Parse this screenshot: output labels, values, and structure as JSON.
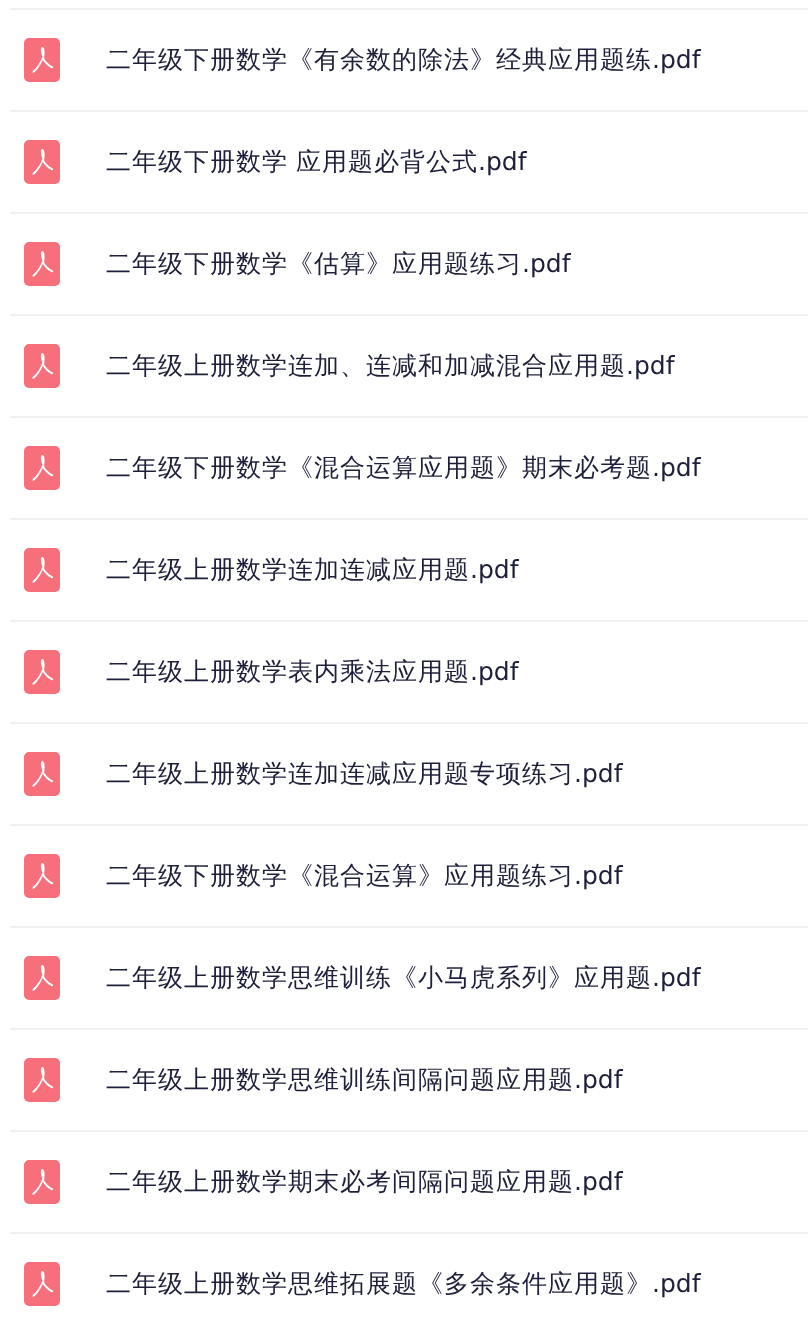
{
  "files": [
    {
      "name": "二年级下册数学《有余数的除法》经典应用题练.pdf"
    },
    {
      "name": "二年级下册数学 应用题必背公式.pdf"
    },
    {
      "name": "二年级下册数学《估算》应用题练习.pdf"
    },
    {
      "name": "二年级上册数学连加、连减和加减混合应用题.pdf"
    },
    {
      "name": "二年级下册数学《混合运算应用题》期末必考题.pdf"
    },
    {
      "name": "二年级上册数学连加连减应用题.pdf"
    },
    {
      "name": "二年级上册数学表内乘法应用题.pdf"
    },
    {
      "name": "二年级上册数学连加连减应用题专项练习.pdf"
    },
    {
      "name": "二年级下册数学《混合运算》应用题练习.pdf"
    },
    {
      "name": "二年级上册数学思维训练《小马虎系列》应用题.pdf"
    },
    {
      "name": "二年级上册数学思维训练间隔问题应用题.pdf"
    },
    {
      "name": "二年级上册数学期末必考间隔问题应用题.pdf"
    },
    {
      "name": "二年级上册数学思维拓展题《多余条件应用题》.pdf"
    }
  ]
}
